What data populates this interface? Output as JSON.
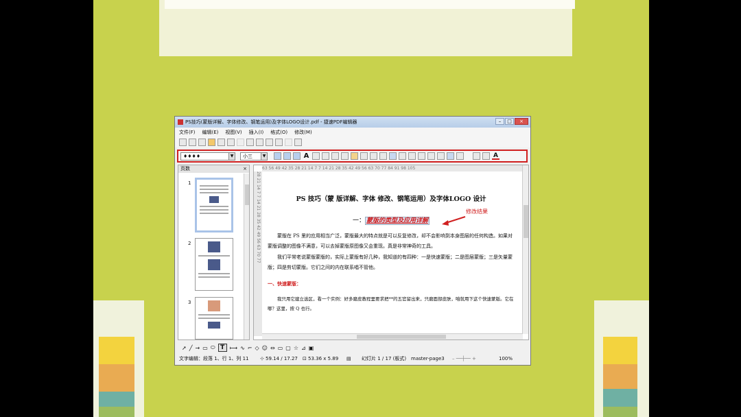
{
  "window": {
    "title": "PS技巧(蒙版详解、字体修改、钢笔运用)及字体LOGO设计.pdf - 捷速PDF编辑器",
    "controls": [
      "–",
      "□",
      "×"
    ]
  },
  "menu": [
    "文件(F)",
    "编辑(E)",
    "视图(V)",
    "插入(I)",
    "格式(O)",
    "修改(M)"
  ],
  "format_toolbar": {
    "font_name": "♦♦♦♦",
    "font_size": "小三",
    "font_color_icon": "A"
  },
  "pages_panel": {
    "title": "页数",
    "close": "×",
    "page_numbers": [
      "1",
      "2",
      "3"
    ]
  },
  "ruler": {
    "horizontal": "63  56  49  42  35  28  21  14   7      7   14  21  28  35  42  49  56  63  70  77  84  91  98 105",
    "vertical": "28   21   14   7      7   14   21   28   35   42   49   56   63   70   77"
  },
  "document": {
    "title": "PS 技巧（蒙 版详解、字体 修改、钢笔运用）及字体LOGO 设计",
    "heading_prefix": "一：",
    "heading": "蒙版的类型及应用详解",
    "annotation": "修改结果",
    "para1": "蒙版在 PS 里的应用相当广泛，蒙版最大的特点就是可以反复修改，却不会影响到本身图层的任何构造。如果对蒙版调整的图像不满意，可以去掉蒙版原图像又会重现。真是非常神奇的工具。",
    "para2": "我们平常老说蒙版蒙版的，实际上蒙版有好几种，我知道的有四种：一是快速蒙版；二是图层蒙版；三是矢量蒙版；四是剪切蒙版。它们之间的内在联系唱不管他。",
    "subheading": "一、快速蒙版：",
    "para3": "我只用它建立选区，看一个实例：好多磨皮教程里要求把**的五官留出来，只磨面部皮肤，咱就用下这个快速蒙版。它在哪？这里，按 Q 也行。"
  },
  "statusbar": {
    "edit_status": "文字编辑：段落 1、行 1、列 11",
    "position": "59.14 / 17.27",
    "size": "53.36 x 5.89",
    "slide": "幻灯片 1 / 17 (板式)",
    "master": "master-page3",
    "zoom": "100%"
  },
  "colors": {
    "slide_bg": "#c8d24d",
    "highlight_red": "#d02020",
    "stripe_yellow": "#f3d33e",
    "stripe_orange": "#e9ab52",
    "stripe_teal": "#6fb0a3"
  }
}
